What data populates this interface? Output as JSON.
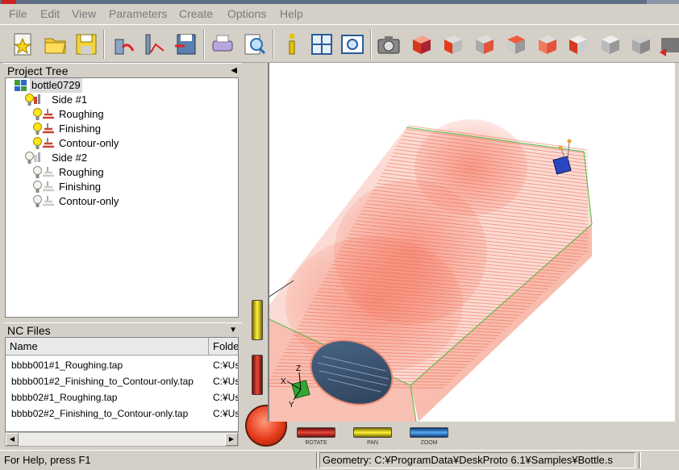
{
  "menu": {
    "items": [
      "File",
      "Edit",
      "View",
      "Parameters",
      "Create",
      "Options",
      "Help"
    ]
  },
  "toolbar": {
    "buttons": [
      "new-project-icon",
      "open-folder-icon",
      "save-icon",
      "toolpath-icon",
      "toolpath-2-icon",
      "save-nc-icon",
      "print-icon",
      "print-preview-icon",
      "info-icon",
      "layout-icon",
      "zoom-window-icon",
      "camera-icon",
      "view-front-icon",
      "view-back-icon",
      "view-left-icon",
      "view-right-icon",
      "view-top-icon",
      "view-bottom-icon",
      "view-iso-icon",
      "view-iso-2-icon",
      "exit-view-icon"
    ]
  },
  "project_tree": {
    "title": "Project Tree",
    "root": "bottle0729",
    "nodes": [
      {
        "label": "Side #1",
        "level": 1,
        "active": true
      },
      {
        "label": "Roughing",
        "level": 2,
        "active": true
      },
      {
        "label": "Finishing",
        "level": 2,
        "active": true
      },
      {
        "label": "Contour-only",
        "level": 2,
        "active": true
      },
      {
        "label": "Side #2",
        "level": 1,
        "active": false
      },
      {
        "label": "Roughing",
        "level": 2,
        "active": false
      },
      {
        "label": "Finishing",
        "level": 2,
        "active": false
      },
      {
        "label": "Contour-only",
        "level": 2,
        "active": false
      }
    ]
  },
  "nc_files": {
    "title": "NC Files",
    "columns": [
      "Name",
      "Folde"
    ],
    "rows": [
      {
        "name": "bbbb001#1_Roughing.tap",
        "folder": "C:¥Us"
      },
      {
        "name": "bbbb001#2_Finishing_to_Contour-only.tap",
        "folder": "C:¥Us"
      },
      {
        "name": "bbbb02#1_Roughing.tap",
        "folder": "C:¥Us"
      },
      {
        "name": "bbbb02#2_Finishing_to_Contour-only.tap",
        "folder": "C:¥Us"
      }
    ]
  },
  "viewport": {
    "controls": [
      "ROTATE",
      "PAN",
      "ZOOM"
    ],
    "axes": [
      "X",
      "Y",
      "Z"
    ]
  },
  "status": {
    "help": "For Help, press F1",
    "geometry": "Geometry: C:¥ProgramData¥DeskProto 6.1¥Samples¥Bottle.s"
  },
  "colors": {
    "toolpath": "#f2664c",
    "background": "#d4d0c8",
    "rotate": "#d4362a",
    "pan": "#e8d21a",
    "zoom": "#3a86d8"
  }
}
